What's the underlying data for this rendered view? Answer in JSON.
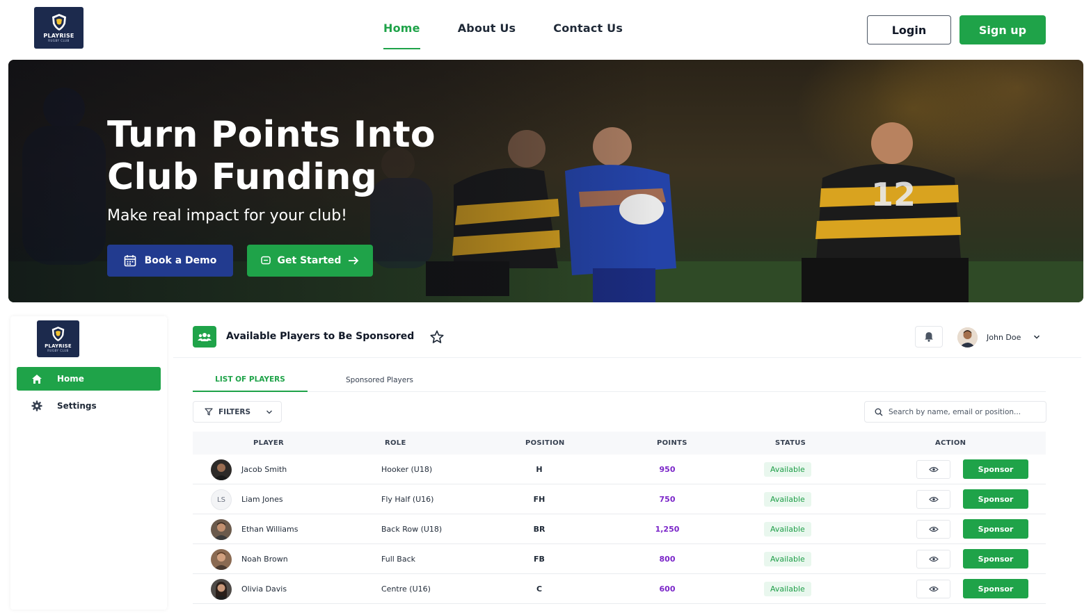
{
  "brand": {
    "name": "PLAYRISE",
    "sub": "RUGBY CLUB"
  },
  "nav": {
    "links": [
      {
        "label": "Home",
        "active": true
      },
      {
        "label": "About Us",
        "active": false
      },
      {
        "label": "Contact Us",
        "active": false
      }
    ],
    "login_label": "Login",
    "signup_label": "Sign up"
  },
  "hero": {
    "title_line1": "Turn Points Into",
    "title_line2": "Club Funding",
    "subtitle": "Make real impact for your club!",
    "demo_label": "Book a Demo",
    "start_label": "Get Started"
  },
  "sidebar": {
    "items": [
      {
        "label": "Home",
        "icon": "home-icon",
        "active": true
      },
      {
        "label": "Settings",
        "icon": "gear-icon",
        "active": false
      }
    ]
  },
  "dashboard": {
    "title": "Available Players to Be Sponsored",
    "user_name": "John Doe",
    "tabs": [
      {
        "label": "LIST OF PLAYERS",
        "active": true
      },
      {
        "label": "Sponsored Players",
        "active": false
      }
    ],
    "filters_label": "FILTERS",
    "search_placeholder": "Search by name, email or position...",
    "columns": [
      "PLAYER",
      "ROLE",
      "POSITION",
      "POINTS",
      "STATUS",
      "ACTION"
    ],
    "action_label": "Sponsor",
    "players": [
      {
        "name": "Jacob Smith",
        "role": "Hooker (U18)",
        "position": "H",
        "points": "950",
        "status": "Available",
        "initials": ""
      },
      {
        "name": "Liam Jones",
        "role": "Fly Half (U16)",
        "position": "FH",
        "points": "750",
        "status": "Available",
        "initials": "LS"
      },
      {
        "name": "Ethan Williams",
        "role": "Back Row (U18)",
        "position": "BR",
        "points": "1,250",
        "status": "Available",
        "initials": ""
      },
      {
        "name": "Noah Brown",
        "role": "Full Back",
        "position": "FB",
        "points": "800",
        "status": "Available",
        "initials": ""
      },
      {
        "name": "Olivia Davis",
        "role": "Centre (U16)",
        "position": "C",
        "points": "600",
        "status": "Available",
        "initials": ""
      }
    ]
  },
  "colors": {
    "accent": "#1fa349",
    "navy": "#223b8f",
    "points": "#7b26c9",
    "badge_bg": "#e9f7ee"
  }
}
